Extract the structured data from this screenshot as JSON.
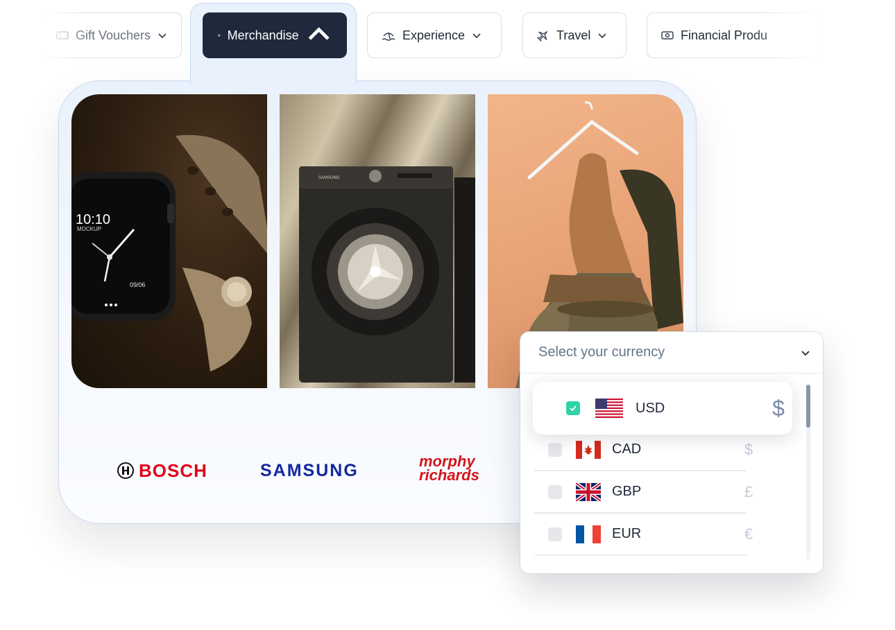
{
  "tabs": {
    "gift": {
      "label": "Gift Vouchers"
    },
    "merch": {
      "label": "Merchandise"
    },
    "experience": {
      "label": "Experience"
    },
    "travel": {
      "label": "Travel"
    },
    "financial": {
      "label": "Financial Produ"
    }
  },
  "brands": {
    "bosch": "BOSCH",
    "samsung": "SAMSUNG",
    "morphy_line1": "morphy",
    "morphy_line2": "richards"
  },
  "watch_face": {
    "time": "10:10",
    "label": "MOCKUP",
    "date": "09/06"
  },
  "washer_brand": "SAMSUNG",
  "currency": {
    "placeholder": "Select your currency",
    "items": [
      {
        "code": "USD",
        "symbol": "$",
        "selected": true
      },
      {
        "code": "CAD",
        "symbol": "$",
        "selected": false
      },
      {
        "code": "GBP",
        "symbol": "£",
        "selected": false
      },
      {
        "code": "EUR",
        "symbol": "€",
        "selected": false
      }
    ]
  },
  "colors": {
    "accent_dark": "#1e293b",
    "check_green": "#2dd4a6",
    "bosch_red": "#e2001a",
    "samsung_blue": "#1428a0"
  }
}
